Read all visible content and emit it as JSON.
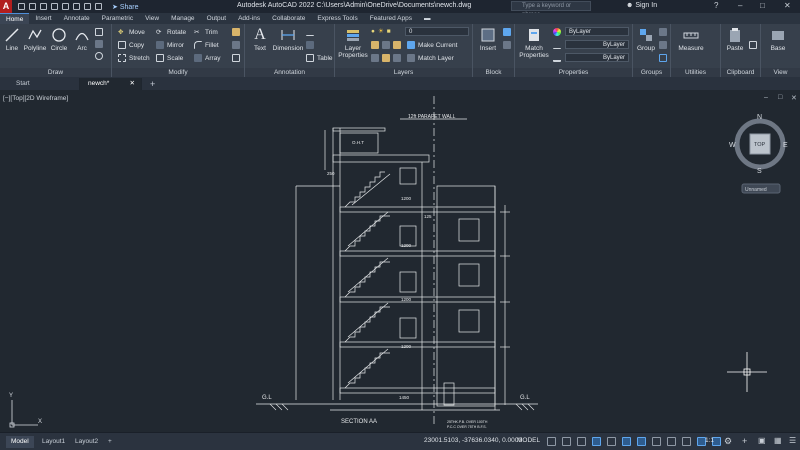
{
  "titlebar": {
    "app_title": "Autodesk AutoCAD 2022    C:\\Users\\Admin\\OneDrive\\Documents\\newch.dwg",
    "share_label": "Share",
    "search_placeholder": "Type a keyword or phrase",
    "signin_label": "Sign In"
  },
  "ribbon_tabs": [
    "Home",
    "Insert",
    "Annotate",
    "Parametric",
    "View",
    "Manage",
    "Output",
    "Add-ins",
    "Collaborate",
    "Express Tools",
    "Featured Apps"
  ],
  "ribbon": {
    "draw": {
      "title": "Draw",
      "line": "Line",
      "polyline": "Polyline",
      "circle": "Circle",
      "arc": "Arc"
    },
    "modify": {
      "title": "Modify",
      "move": "Move",
      "rotate": "Rotate",
      "trim": "Trim",
      "copy": "Copy",
      "mirror": "Mirror",
      "fillet": "Fillet",
      "stretch": "Stretch",
      "scale": "Scale",
      "array": "Array"
    },
    "annotation": {
      "title": "Annotation",
      "text": "Text",
      "dimension": "Dimension",
      "table": "Table"
    },
    "layers": {
      "title": "Layers",
      "layer_properties": "Layer Properties",
      "current_layer": "0",
      "make_current": "Make Current",
      "match_layer": "Match Layer"
    },
    "block": {
      "title": "Block",
      "insert": "Insert"
    },
    "properties": {
      "title": "Properties",
      "match_properties": "Match Properties",
      "color": "ByLayer",
      "linetype": "ByLayer",
      "lineweight": "ByLayer"
    },
    "groups": {
      "title": "Groups",
      "group": "Group"
    },
    "utilities": {
      "title": "Utilities",
      "measure": "Measure"
    },
    "clipboard": {
      "title": "Clipboard",
      "paste": "Paste"
    },
    "view": {
      "title": "View",
      "base": "Base"
    }
  },
  "file_tabs": {
    "start": "Start",
    "active": "newch*"
  },
  "viewport": {
    "label": "[−][Top][2D Wireframe]",
    "viewcube": {
      "top": "TOP",
      "n": "N",
      "e": "E",
      "s": "S",
      "w": "W",
      "ucs_name": "Unnamed"
    }
  },
  "drawing": {
    "parapet": "12ft PARAPET WALL",
    "oht": "O.H.T",
    "section": "SECTION AA",
    "gl_left": "G.L",
    "gl_right": "G.L",
    "foundation_note_1": "25THK.P.B. OVER 100TH",
    "foundation_note_2": "P.C.C OVER 75TH B.F.S.",
    "dim_1200": "1200",
    "dim_250": "250",
    "dim_125": "125",
    "dim_1450": "1450"
  },
  "statusbar": {
    "layout_tabs": [
      "Model",
      "Layout1",
      "Layout2"
    ],
    "coordinates": "23001.5103, -37636.0340, 0.0000",
    "space": "MODEL",
    "scale": "1:1"
  }
}
